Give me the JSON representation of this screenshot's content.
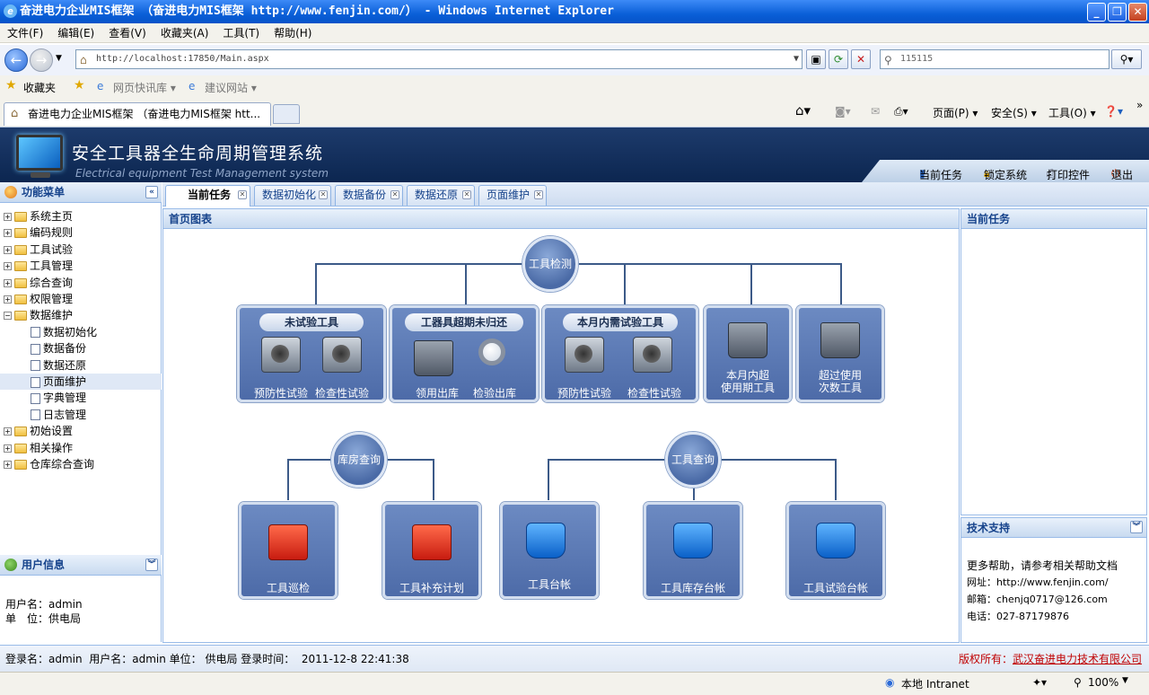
{
  "window": {
    "title": "奋进电力企业MIS框架 （奋进电力MIS框架 http://www.fenjin.com/） - Windows Internet Explorer"
  },
  "menu": [
    "文件(F)",
    "编辑(E)",
    "查看(V)",
    "收藏夹(A)",
    "工具(T)",
    "帮助(H)"
  ],
  "address": {
    "url": "http://localhost:17850/Main.aspx",
    "search": "115115"
  },
  "favbar": {
    "favorites": "收藏夹",
    "item1": "网页快讯库 ▾",
    "item2": "建议网站 ▾"
  },
  "browser_tab": {
    "title": "奋进电力企业MIS框架 （奋进电力MIS框架 htt..."
  },
  "ie_tools": {
    "page": "页面(P) ▾",
    "safety": "安全(S) ▾",
    "tools": "工具(O) ▾"
  },
  "app": {
    "title": "安全工具器全生命周期管理系统",
    "subtitle": "Electrical equipment Test Management system",
    "top_links": [
      "当前任务",
      "锁定系统",
      "打印控件",
      "退出"
    ]
  },
  "left": {
    "menu_title": "功能菜单",
    "tree": [
      {
        "label": "系统主页",
        "level": 0,
        "type": "folder",
        "sign": "+"
      },
      {
        "label": "编码规则",
        "level": 0,
        "type": "folder",
        "sign": "+"
      },
      {
        "label": "工具试验",
        "level": 0,
        "type": "folder",
        "sign": "+"
      },
      {
        "label": "工具管理",
        "level": 0,
        "type": "folder",
        "sign": "+"
      },
      {
        "label": "综合查询",
        "level": 0,
        "type": "folder",
        "sign": "+"
      },
      {
        "label": "权限管理",
        "level": 0,
        "type": "folder",
        "sign": "+"
      },
      {
        "label": "数据维护",
        "level": 0,
        "type": "folder",
        "sign": "-"
      },
      {
        "label": "数据初始化",
        "level": 1,
        "type": "doc"
      },
      {
        "label": "数据备份",
        "level": 1,
        "type": "doc"
      },
      {
        "label": "数据还原",
        "level": 1,
        "type": "doc"
      },
      {
        "label": "页面维护",
        "level": 1,
        "type": "doc",
        "selected": true
      },
      {
        "label": "字典管理",
        "level": 1,
        "type": "doc"
      },
      {
        "label": "日志管理",
        "level": 1,
        "type": "doc"
      },
      {
        "label": "初始设置",
        "level": 0,
        "type": "folder",
        "sign": "+"
      },
      {
        "label": "相关操作",
        "level": 0,
        "type": "folder",
        "sign": "+"
      },
      {
        "label": "仓库综合查询",
        "level": 0,
        "type": "folder",
        "sign": "+"
      }
    ],
    "user_title": "用户信息",
    "user_name": "用户名：admin",
    "user_unit": "单　位：供电局"
  },
  "tabs": [
    "当前任务",
    "数据初始化",
    "数据备份",
    "数据还原",
    "页面维护"
  ],
  "main": {
    "title": "首页图表",
    "circles": {
      "tool_check": "工具检测",
      "store_query": "库房查询",
      "tool_query": "工具查询"
    },
    "boxes": {
      "untested": {
        "header": "未试验工具",
        "items": [
          "预防性试验",
          "检查性试验"
        ]
      },
      "overdue": {
        "header": "工器具超期未归还",
        "items": [
          "领用出库",
          "检验出库"
        ]
      },
      "month_test": {
        "header": "本月内需试验工具",
        "items": [
          "预防性试验",
          "检查性试验"
        ]
      },
      "month_expire": {
        "label1": "本月内超",
        "label2": "使用期工具"
      },
      "over_use": {
        "label1": "超过使用",
        "label2": "次数工具"
      },
      "patrol": {
        "label": "工具巡检"
      },
      "supplement": {
        "label": "工具补充计划"
      },
      "ledger": {
        "label": "工具台帐"
      },
      "stock_ledger": {
        "label": "工具库存台帐"
      },
      "test_ledger": {
        "label": "工具试验台帐"
      }
    }
  },
  "right": {
    "task_title": "当前任务",
    "support_title": "技术支持",
    "support_lines": [
      "更多帮助，请参考相关帮助文档",
      "网址：http://www.fenjin.com/",
      "邮箱：chenjq0717@126.com",
      "电话：027-87179876"
    ]
  },
  "status": {
    "text": "登录名：admin  用户名：admin 单位： 供电局 登录时间：  2011-12-8 22:41:38",
    "copyright_label": "版权所有：",
    "copyright_company": "武汉奋进电力技术有限公司"
  },
  "iestatus": {
    "zone": "本地 Intranet",
    "zoom": "100%"
  }
}
